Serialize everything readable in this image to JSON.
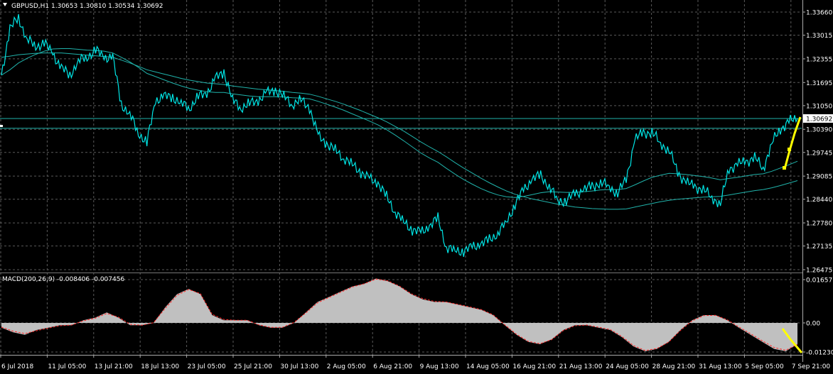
{
  "colors": {
    "background": "#000000",
    "grid": "#5a5a5a",
    "price_line": "#00e5e5",
    "moving_averages": "#20b2aa",
    "macd_hist_fill": "#c0c0c0",
    "macd_signal": "#ff2a2a",
    "arrow": "#ffff00",
    "text": "#ffffff",
    "current_price_box": "#ffffff"
  },
  "header": {
    "symbol_info": "GBPUSD,H1  1.30653 1.30810 1.30534 1.30692",
    "macd_info": "MACD(200,26,9) -0.008406 -0.007456"
  },
  "chart_data": [
    {
      "type": "line",
      "series_name": "GBPUSD,H1",
      "ylim": [
        1.262,
        1.3378
      ],
      "y_ticks": [
        "1.33660",
        "1.33015",
        "1.32355",
        "1.31695",
        "1.31050",
        "1.30390",
        "1.29745",
        "1.29085",
        "1.28440",
        "1.27780",
        "1.27135",
        "1.26475"
      ],
      "y_tick_values": [
        1.3366,
        1.33015,
        1.32355,
        1.31695,
        1.3105,
        1.3039,
        1.29745,
        1.29085,
        1.2844,
        1.2778,
        1.27135,
        1.26475
      ],
      "current_price": 1.30692,
      "current_price_label": "1.30692",
      "horizontal_lines": [
        1.30692,
        1.3042
      ],
      "x_labels": [
        "6 Jul 2018",
        "11 Jul 05:00",
        "13 Jul 21:00",
        "18 Jul 13:00",
        "23 Jul 05:00",
        "25 Jul 21:00",
        "30 Jul 13:00",
        "2 Aug 05:00",
        "6 Aug 21:00",
        "9 Aug 13:00",
        "14 Aug 05:00",
        "16 Aug 21:00",
        "21 Aug 13:00",
        "24 Aug 05:00",
        "28 Aug 21:00",
        "31 Aug 13:00",
        "5 Sep 05:00",
        "7 Sep 21:00"
      ],
      "price": [
        1.319,
        1.332,
        1.335,
        1.329,
        1.327,
        1.328,
        1.325,
        1.321,
        1.319,
        1.323,
        1.324,
        1.326,
        1.324,
        1.324,
        1.311,
        1.308,
        1.303,
        1.3,
        1.312,
        1.313,
        1.313,
        1.311,
        1.31,
        1.313,
        1.314,
        1.318,
        1.32,
        1.312,
        1.31,
        1.311,
        1.312,
        1.314,
        1.315,
        1.313,
        1.311,
        1.312,
        1.31,
        1.302,
        1.3,
        1.298,
        1.296,
        1.294,
        1.292,
        1.29,
        1.289,
        1.285,
        1.281,
        1.278,
        1.276,
        1.275,
        1.277,
        1.279,
        1.271,
        1.27,
        1.27,
        1.271,
        1.272,
        1.273,
        1.275,
        1.278,
        1.283,
        1.287,
        1.29,
        1.291,
        1.288,
        1.284,
        1.284,
        1.286,
        1.287,
        1.288,
        1.289,
        1.288,
        1.286,
        1.29,
        1.301,
        1.303,
        1.303,
        1.3,
        1.298,
        1.292,
        1.289,
        1.288,
        1.287,
        1.285,
        1.283,
        1.293,
        1.294,
        1.295,
        1.296,
        1.293,
        1.3,
        1.304,
        1.306,
        1.3069
      ],
      "ma_fast": [
        1.319,
        1.3205,
        1.3224,
        1.3237,
        1.3248,
        1.3257,
        1.3263,
        1.3264,
        1.3264,
        1.3262,
        1.326,
        1.3259,
        1.3257,
        1.3252,
        1.324,
        1.3227,
        1.3212,
        1.3195,
        1.3186,
        1.3177,
        1.3168,
        1.316,
        1.3153,
        1.3148,
        1.3144,
        1.3142,
        1.3142,
        1.3138,
        1.3135,
        1.3132,
        1.313,
        1.313,
        1.313,
        1.3129,
        1.3127,
        1.3126,
        1.3124,
        1.3117,
        1.3109,
        1.3101,
        1.3092,
        1.3082,
        1.3072,
        1.3062,
        1.3051,
        1.3038,
        1.3023,
        1.3007,
        1.299,
        1.2973,
        1.2959,
        1.2947,
        1.293,
        1.2914,
        1.2899,
        1.2886,
        1.2874,
        1.2864,
        1.2856,
        1.2851,
        1.2849,
        1.2852,
        1.2857,
        1.2862,
        1.2865,
        1.2864,
        1.2863,
        1.2863,
        1.2865,
        1.2867,
        1.287,
        1.2871,
        1.2871,
        1.2874,
        1.2884,
        1.2895,
        1.2905,
        1.2911,
        1.2916,
        1.2915,
        1.2913,
        1.291,
        1.2907,
        1.2903,
        1.2898,
        1.2902,
        1.2905,
        1.2909,
        1.2913,
        1.2915,
        1.2922,
        1.2931,
        1.294,
        1.295
      ],
      "ma_slow": [
        1.324,
        1.3243,
        1.3247,
        1.3249,
        1.3251,
        1.3252,
        1.3252,
        1.3252,
        1.325,
        1.3248,
        1.3246,
        1.3244,
        1.3242,
        1.324,
        1.3232,
        1.3224,
        1.3215,
        1.3205,
        1.3199,
        1.3193,
        1.3187,
        1.3181,
        1.3176,
        1.3172,
        1.3168,
        1.3166,
        1.3164,
        1.316,
        1.3157,
        1.3154,
        1.3151,
        1.3149,
        1.3147,
        1.3145,
        1.3142,
        1.314,
        1.3137,
        1.3131,
        1.3124,
        1.3117,
        1.3109,
        1.31,
        1.3091,
        1.3081,
        1.3071,
        1.306,
        1.3047,
        1.3034,
        1.3019,
        1.3004,
        1.299,
        1.2977,
        1.2962,
        1.2946,
        1.2931,
        1.2917,
        1.2903,
        1.289,
        1.2878,
        1.2867,
        1.2858,
        1.2851,
        1.2845,
        1.284,
        1.2835,
        1.283,
        1.2826,
        1.2822,
        1.282,
        1.2818,
        1.2817,
        1.2816,
        1.2816,
        1.2817,
        1.2822,
        1.2827,
        1.2832,
        1.2837,
        1.2841,
        1.2844,
        1.2846,
        1.2848,
        1.285,
        1.2851,
        1.2852,
        1.2856,
        1.286,
        1.2864,
        1.2868,
        1.2871,
        1.2876,
        1.2882,
        1.2889,
        1.2896
      ]
    },
    {
      "type": "area",
      "series_name": "MACD(200,26,9)",
      "macd_value": -0.008406,
      "signal_value": -0.007456,
      "ylim": [
        -0.0131,
        0.0175
      ],
      "y_ticks": [
        "0.01657",
        "0.00",
        "-0.012307"
      ],
      "y_tick_values": [
        0.01657,
        0.0,
        -0.012307
      ],
      "histogram": [
        -0.002,
        -0.004,
        -0.005,
        -0.003,
        -0.002,
        -0.001,
        -0.001,
        0.001,
        0.002,
        0.004,
        0.002,
        -0.001,
        -0.001,
        0.0,
        0.006,
        0.011,
        0.013,
        0.011,
        0.003,
        0.001,
        0.001,
        0.001,
        -0.001,
        -0.002,
        -0.002,
        0.0,
        0.004,
        0.008,
        0.01,
        0.012,
        0.014,
        0.015,
        0.017,
        0.016,
        0.014,
        0.011,
        0.009,
        0.008,
        0.008,
        0.007,
        0.006,
        0.005,
        0.003,
        -0.001,
        -0.005,
        -0.008,
        -0.009,
        -0.007,
        -0.003,
        -0.001,
        -0.001,
        -0.002,
        -0.003,
        -0.006,
        -0.01,
        -0.012,
        -0.011,
        -0.008,
        -0.003,
        0.001,
        0.003,
        0.003,
        0.001,
        -0.002,
        -0.005,
        -0.008,
        -0.011,
        -0.012,
        -0.009
      ],
      "signal": [
        -0.0018,
        -0.0035,
        -0.0045,
        -0.0033,
        -0.0022,
        -0.0012,
        -0.0009,
        0.0008,
        0.0018,
        0.0036,
        0.0022,
        -0.0006,
        -0.001,
        0.0001,
        0.0056,
        0.0106,
        0.0128,
        0.0112,
        0.0033,
        0.0013,
        0.001,
        0.001,
        -0.0008,
        -0.0019,
        -0.0019,
        0.0002,
        0.0038,
        0.0077,
        0.0098,
        0.0118,
        0.0138,
        0.015,
        0.0168,
        0.0161,
        0.0141,
        0.0112,
        0.0093,
        0.0082,
        0.008,
        0.0071,
        0.0061,
        0.0051,
        0.0031,
        -0.0008,
        -0.0048,
        -0.0078,
        -0.0088,
        -0.0071,
        -0.0032,
        -0.0012,
        -0.0009,
        -0.0018,
        -0.0028,
        -0.0057,
        -0.0096,
        -0.0117,
        -0.0108,
        -0.0081,
        -0.0032,
        0.0008,
        0.0028,
        0.0029,
        0.0012,
        -0.0017,
        -0.0046,
        -0.0076,
        -0.0104,
        -0.0116,
        -0.0091
      ]
    }
  ]
}
